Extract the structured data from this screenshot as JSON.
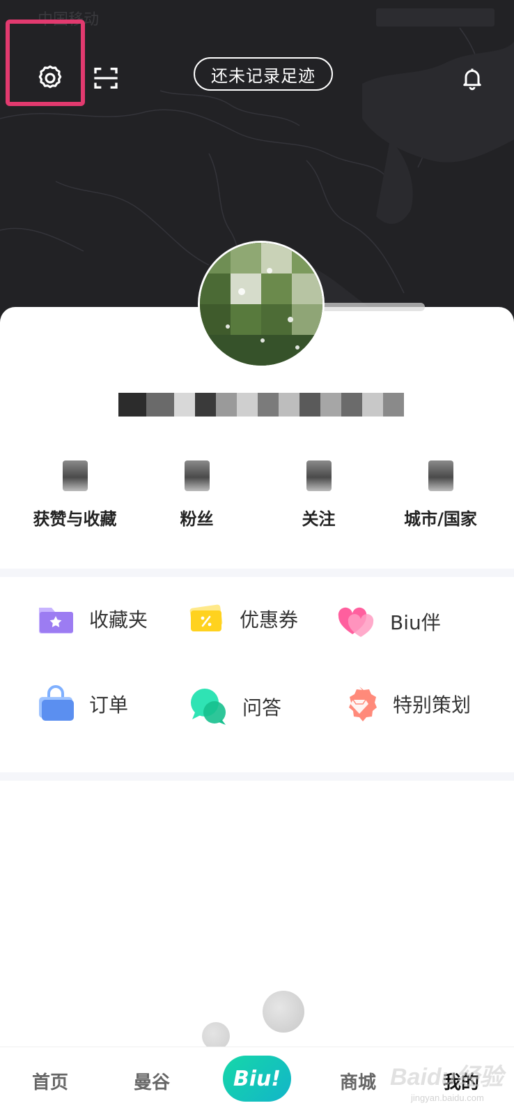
{
  "status_bar": {
    "carrier": "中国移动"
  },
  "header": {
    "footprint_label": "还未记录足迹",
    "icons": {
      "settings": "gear-icon",
      "scan": "scan-icon",
      "notification": "bell-icon"
    }
  },
  "profile": {
    "stats": [
      {
        "label": "获赞与收藏"
      },
      {
        "label": "粉丝"
      },
      {
        "label": "关注"
      },
      {
        "label": "城市/国家"
      }
    ]
  },
  "menu": {
    "items": [
      {
        "label": "收藏夹",
        "icon": "folder-star-icon",
        "color": "#a98bf0"
      },
      {
        "label": "优惠券",
        "icon": "coupon-icon",
        "color": "#ffd21f"
      },
      {
        "label": "Biu伴",
        "icon": "heart-icon",
        "color": "#ff6fa8"
      },
      {
        "label": "订单",
        "icon": "bag-icon",
        "color": "#5b8ff0"
      },
      {
        "label": "问答",
        "icon": "chat-bubble-icon",
        "color": "#1fd6a5"
      },
      {
        "label": "特别策划",
        "icon": "diamond-badge-icon",
        "color": "#ff7a6b"
      }
    ]
  },
  "tab_bar": {
    "tabs": [
      {
        "label": "首页"
      },
      {
        "label": "曼谷"
      },
      {
        "label": "Biu!"
      },
      {
        "label": "商城"
      },
      {
        "label": "我的"
      }
    ],
    "active": "我的"
  },
  "watermark": {
    "text": "Baidu经验",
    "sub": "jingyan.baidu.com"
  }
}
